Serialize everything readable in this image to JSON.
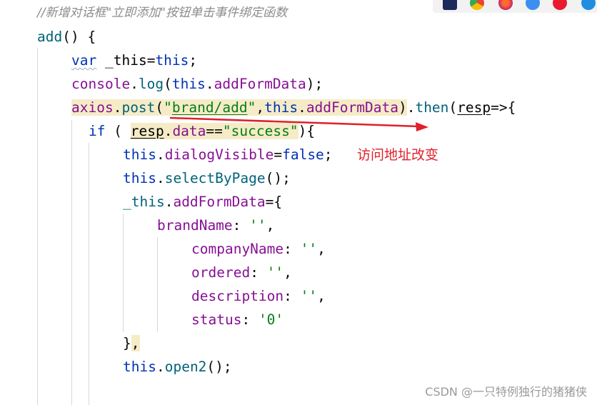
{
  "editor": {
    "comment": "//新增对话框\"立即添加\"按钮单击事件绑定函数",
    "lines": {
      "l2": {
        "name": "add",
        "rest": "() {"
      },
      "l3": {
        "kw": "var",
        "var": "_this",
        "eq": "=",
        "this": "this",
        "end": ";"
      },
      "l4": {
        "obj": "console",
        "dot1": ".",
        "fn": "log",
        "p1": "(",
        "this": "this",
        "dot2": ".",
        "prop": "addFormData",
        "p2": ");"
      },
      "l5": {
        "obj": "axios",
        "dot1": ".",
        "fn": "post",
        "p1": "(",
        "q1": "\"",
        "url": "brand/add",
        "q2": "\"",
        "comma": ",",
        "this": "this",
        "dot2": ".",
        "prop": "addFormData",
        "p2": ")",
        "dot3": ".",
        "then": "then",
        "p3": "(",
        "arg": "resp",
        "arrow": "=>{"
      },
      "l6": {
        "kw": "if",
        "p1": " ( ",
        "resp": "resp",
        "dot": ".",
        "prop": "data",
        "eq": "==",
        "str": "\"success\"",
        "p2": "){"
      },
      "l7": {
        "this": "this",
        "dot": ".",
        "prop": "dialogVisible",
        "eq": "=",
        "kw": "false",
        "end": ";"
      },
      "l8": {
        "this": "this",
        "dot": ".",
        "fn": "selectByPage",
        "end": "();"
      },
      "l9": {
        "var": "_this",
        "dot": ".",
        "prop": "addFormData",
        "end": "={"
      },
      "l10": {
        "key": "brandName",
        "colon": ": ",
        "val": "''",
        "end": ","
      },
      "l11": {
        "key": "companyName",
        "colon": ": ",
        "val": "''",
        "end": ","
      },
      "l12": {
        "key": "ordered",
        "colon": ": ",
        "val": "''",
        "end": ","
      },
      "l13": {
        "key": "description",
        "colon": ": ",
        "val": "''",
        "end": ","
      },
      "l14": {
        "key": "status",
        "colon": ": ",
        "val": "'0'"
      },
      "l15": {
        "brace": "}",
        "comma": ","
      },
      "l16": {
        "this": "this",
        "dot": ".",
        "fn": "open2",
        "end": "();"
      }
    }
  },
  "annotation": {
    "text": "访问地址改变",
    "color": "#e0202a"
  },
  "watermark": {
    "text": "CSDN @一只特例独行的猪猪侠"
  },
  "browser_icons": [
    "jetbrains-icon",
    "chrome-icon",
    "firefox-icon",
    "safari-icon",
    "opera-icon",
    "edge-icon"
  ],
  "colors": {
    "keyword": "#0033b3",
    "function": "#00627a",
    "property": "#871094",
    "string": "#067d17",
    "comment": "#8c8c8c",
    "highlight": "#f5ecc7"
  }
}
